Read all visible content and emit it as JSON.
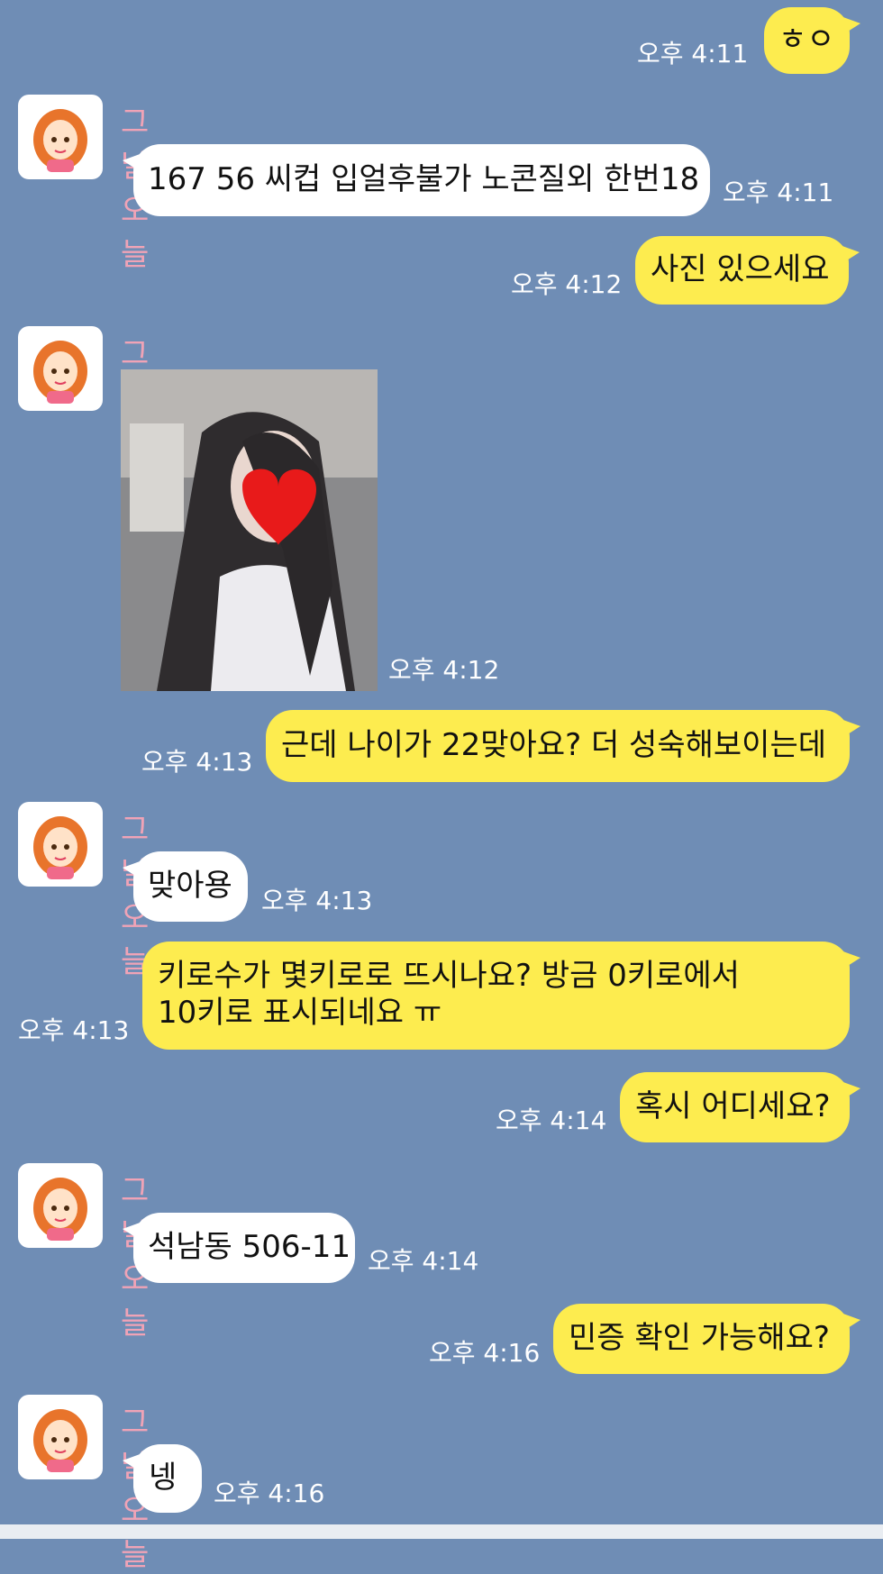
{
  "contact": {
    "name": "그날오늘"
  },
  "messages": [
    {
      "from": "me",
      "text": "ㅎㅇ",
      "time": "오후 4:11"
    },
    {
      "from": "them",
      "text": "167 56 씨컵 입얼후불가 노콘질외 한번18",
      "time": "오후 4:11"
    },
    {
      "from": "me",
      "text": "사진 있으세요",
      "time": "오후 4:12"
    },
    {
      "from": "them",
      "text": "",
      "time": "오후 4:12",
      "type": "photo"
    },
    {
      "from": "me",
      "text": "근데 나이가 22맞아요? 더 성숙해보이는데",
      "time": "오후 4:13"
    },
    {
      "from": "them",
      "text": "맞아용",
      "time": "오후 4:13"
    },
    {
      "from": "me",
      "text_line1": "키로수가 몇키로로 뜨시나요? 방금 0키로에서",
      "text_line2": "10키로 표시되네요 ㅠ",
      "time": "오후 4:13"
    },
    {
      "from": "me",
      "text": "혹시 어디세요?",
      "time": "오후 4:14"
    },
    {
      "from": "them",
      "text": "석남동 506-11",
      "time": "오후 4:14"
    },
    {
      "from": "me",
      "text": "민증 확인 가능해요?",
      "time": "오후 4:16"
    },
    {
      "from": "them",
      "text": "넹",
      "time": "오후 4:16"
    }
  ],
  "colors": {
    "background": "#6f8db5",
    "my_bubble": "#fdec4f",
    "their_bubble": "#ffffff",
    "sender_name": "#f0a3b6",
    "time_text": "#ffffff"
  },
  "icons": {
    "avatar": "avatar-icon",
    "photo_sticker": "heart-icon"
  }
}
